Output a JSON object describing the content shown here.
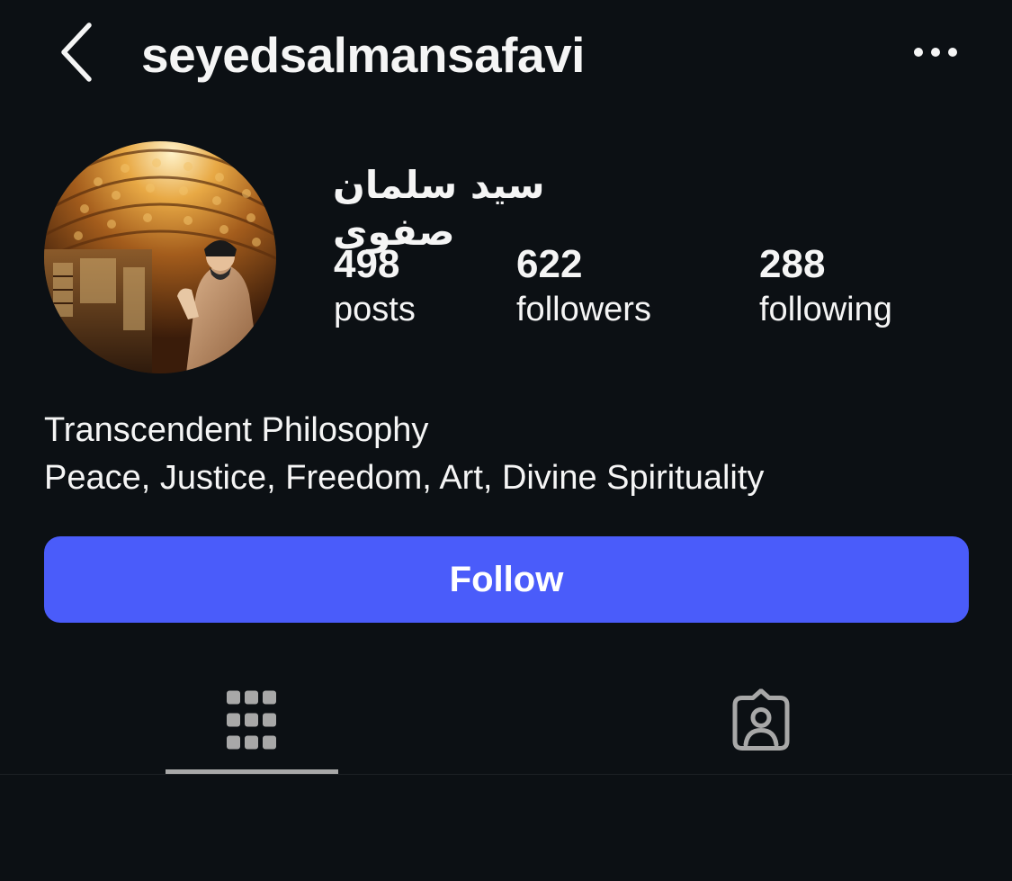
{
  "header": {
    "username": "seyedsalmansafavi",
    "back_icon": "chevron-left-icon",
    "more_icon": "more-horizontal-icon"
  },
  "profile": {
    "display_name": "سید سلمان صفوی",
    "stats": [
      {
        "value": "498",
        "label": "posts"
      },
      {
        "value": "622",
        "label": "followers"
      },
      {
        "value": "288",
        "label": "following"
      }
    ],
    "bio": [
      "Transcendent Philosophy",
      "Peace, Justice, Freedom, Art, Divine Spirituality"
    ]
  },
  "actions": {
    "follow_label": "Follow",
    "follow_color": "#4a5cfa"
  },
  "tabs": [
    {
      "icon": "grid-icon",
      "active": true
    },
    {
      "icon": "tagged-person-icon",
      "active": false
    }
  ],
  "colors": {
    "background": "#0c1014",
    "text": "#f5f5f5",
    "icon_muted": "#a8a8a8"
  }
}
